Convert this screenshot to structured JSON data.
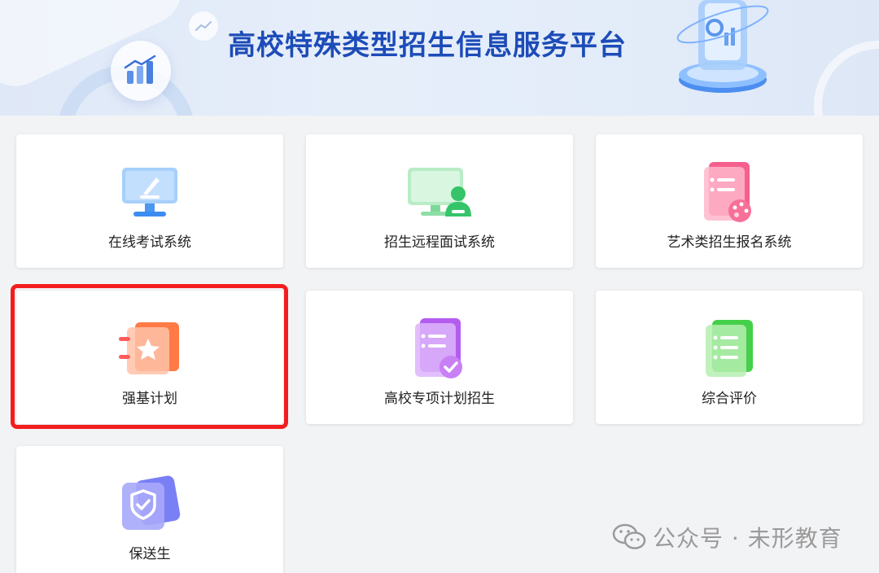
{
  "banner": {
    "title": "高校特殊类型招生信息服务平台"
  },
  "cards": [
    {
      "label": "在线考试系统",
      "icon": "online-exam-icon"
    },
    {
      "label": "招生远程面试系统",
      "icon": "remote-interview-icon"
    },
    {
      "label": "艺术类招生报名系统",
      "icon": "art-registration-icon"
    },
    {
      "label": "强基计划",
      "icon": "strong-foundation-star-icon"
    },
    {
      "label": "高校专项计划招生",
      "icon": "special-plan-check-icon"
    },
    {
      "label": "综合评价",
      "icon": "comprehensive-evaluation-list-icon"
    },
    {
      "label": "保送生",
      "icon": "recommended-student-shield-icon"
    }
  ],
  "watermark": {
    "text": "公众号 · 未形教育"
  },
  "colors": {
    "title_blue": "#1d4cb8",
    "highlight_red": "#f31d1d",
    "exam_blue": "#3b8df0",
    "interview_green": "#35c46a",
    "art_pink": "#f5608e",
    "strong_orange": "#ff7a45",
    "special_purple": "#b45cf0",
    "evaluation_green": "#45d04a",
    "recommend_indigo": "#6a6ff2"
  }
}
